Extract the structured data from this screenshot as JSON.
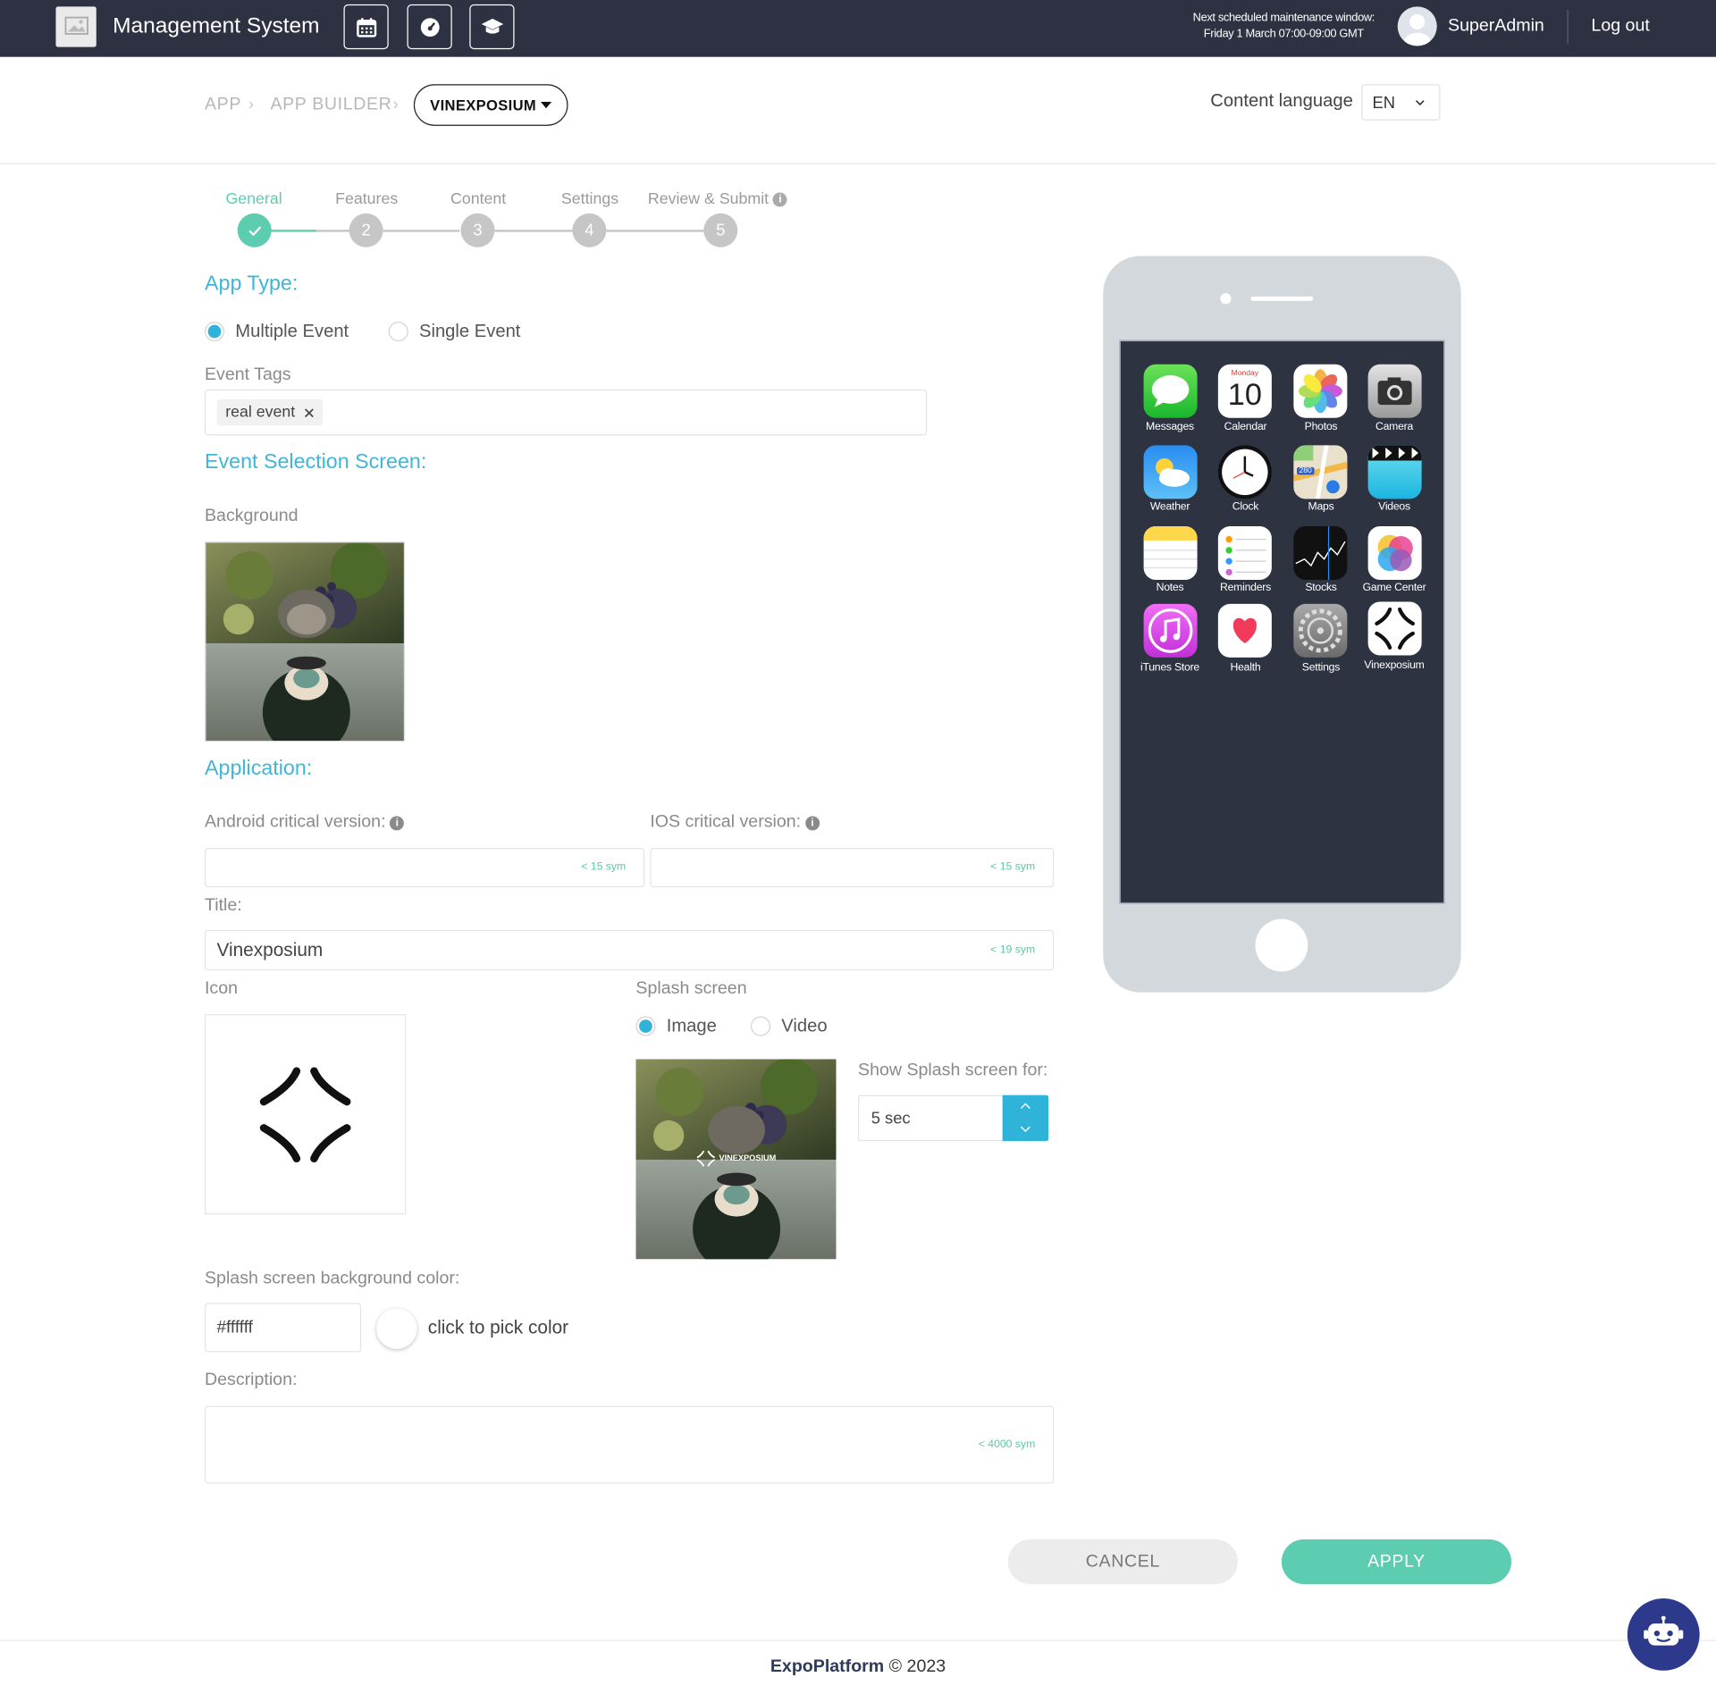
{
  "header": {
    "app_title": "Management System",
    "maintenance_line1": "Next scheduled maintenance window:",
    "maintenance_line2": "Friday 1 March 07:00-09:00 GMT",
    "username": "SuperAdmin",
    "logout": "Log out",
    "nav_icons": [
      "calendar-icon",
      "dashboard-icon",
      "graduation-cap-icon"
    ]
  },
  "breadcrumb": {
    "items": [
      "APP",
      "APP BUILDER"
    ],
    "current": "VINEXPOSIUM"
  },
  "content_language": {
    "label": "Content language",
    "value": "EN"
  },
  "stepper": {
    "steps": [
      {
        "label": "General",
        "number": "1",
        "state": "done"
      },
      {
        "label": "Features",
        "number": "2",
        "state": "todo"
      },
      {
        "label": "Content",
        "number": "3",
        "state": "todo"
      },
      {
        "label": "Settings",
        "number": "4",
        "state": "todo"
      },
      {
        "label": "Review & Submit",
        "number": "5",
        "state": "todo"
      }
    ]
  },
  "app_type": {
    "title": "App Type:",
    "options": [
      "Multiple Event",
      "Single Event"
    ],
    "selected": "Multiple Event"
  },
  "event_tags": {
    "label": "Event Tags",
    "tags": [
      "real event"
    ]
  },
  "event_selection": {
    "title": "Event Selection Screen:",
    "background_label": "Background"
  },
  "application": {
    "title": "Application:",
    "android_label": "Android critical version:",
    "ios_label": "IOS critical version:",
    "android_hint": "< 15 sym",
    "ios_hint": "< 15 sym",
    "title_label": "Title:",
    "title_value": "Vinexposium",
    "title_hint": "< 19 sym",
    "icon_label": "Icon",
    "splash_label": "Splash screen",
    "splash_options": [
      "Image",
      "Video"
    ],
    "splash_selected": "Image",
    "splash_overlay_text": "VINEXPOSIUM",
    "show_splash_label": "Show Splash screen for:",
    "show_splash_value": "5 sec",
    "splash_bg_label": "Splash screen background color:",
    "splash_bg_value": "#ffffff",
    "pick_color": "click to pick color",
    "description_label": "Description:",
    "description_hint": "< 4000 sym"
  },
  "actions": {
    "cancel": "CANCEL",
    "apply": "APPLY"
  },
  "footer": {
    "brand": "ExpoPlatform",
    "copyright": "© 2023"
  },
  "phone": {
    "apps": [
      {
        "name": "Messages",
        "icon": "messages-icon"
      },
      {
        "name": "Calendar",
        "icon": "calendar-app-icon",
        "day": "Monday",
        "date": "10"
      },
      {
        "name": "Photos",
        "icon": "photos-icon"
      },
      {
        "name": "Camera",
        "icon": "camera-icon"
      },
      {
        "name": "Weather",
        "icon": "weather-icon"
      },
      {
        "name": "Clock",
        "icon": "clock-icon"
      },
      {
        "name": "Maps",
        "icon": "maps-icon",
        "badge": "280"
      },
      {
        "name": "Videos",
        "icon": "videos-icon"
      },
      {
        "name": "Notes",
        "icon": "notes-icon"
      },
      {
        "name": "Reminders",
        "icon": "reminders-icon"
      },
      {
        "name": "Stocks",
        "icon": "stocks-icon"
      },
      {
        "name": "Game Center",
        "icon": "game-center-icon"
      },
      {
        "name": "iTunes Store",
        "icon": "itunes-icon"
      },
      {
        "name": "Health",
        "icon": "health-icon"
      },
      {
        "name": "Settings",
        "icon": "settings-icon"
      },
      {
        "name": "Vinexposium",
        "icon": "vinexposium-icon"
      }
    ]
  },
  "colors": {
    "header_bg": "#2d3142",
    "accent_blue": "#2fb3d9",
    "accent_green": "#5ccdb0",
    "phone_screen": "#2e3342"
  }
}
